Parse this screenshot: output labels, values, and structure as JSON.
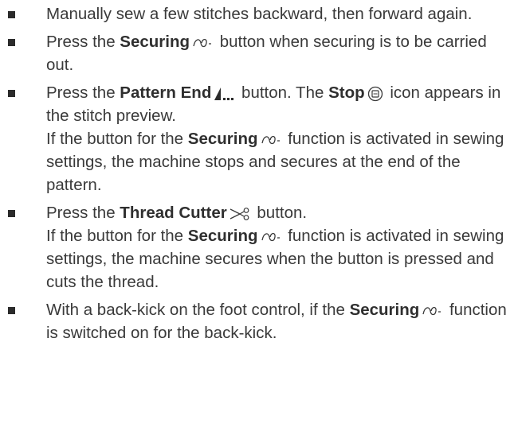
{
  "items": [
    {
      "text": "Manually sew a few stitches backward, then forward again."
    },
    {
      "pre": "Press the ",
      "bold": "Securing",
      "post": " button when securing is to be carried out.",
      "icon": "securing-icon"
    },
    {
      "pre": "Press the ",
      "bold": "Pattern End",
      "mid": " button. The ",
      "bold2": "Stop",
      "post": " icon appears in the stitch preview.",
      "note_pre": "If the button for the ",
      "note_bold": "Securing",
      "note_post": " function is activated in sewing settings, the machine stops and secures at the end of the pattern."
    },
    {
      "pre": "Press the ",
      "bold": "Thread Cutter",
      "post": " button.",
      "note_pre": "If the button for the ",
      "note_bold": "Securing",
      "note_post": " function is activated in sewing settings, the machine secures when the button is pressed and cuts the thread."
    },
    {
      "pre": "With a back-kick on the foot control, if the ",
      "bold": "Securing",
      "post": " function is switched on for the back-kick."
    }
  ],
  "icons": [
    "securing-icon",
    "pattern-end-icon",
    "stop-icon",
    "thread-cutter-icon"
  ]
}
